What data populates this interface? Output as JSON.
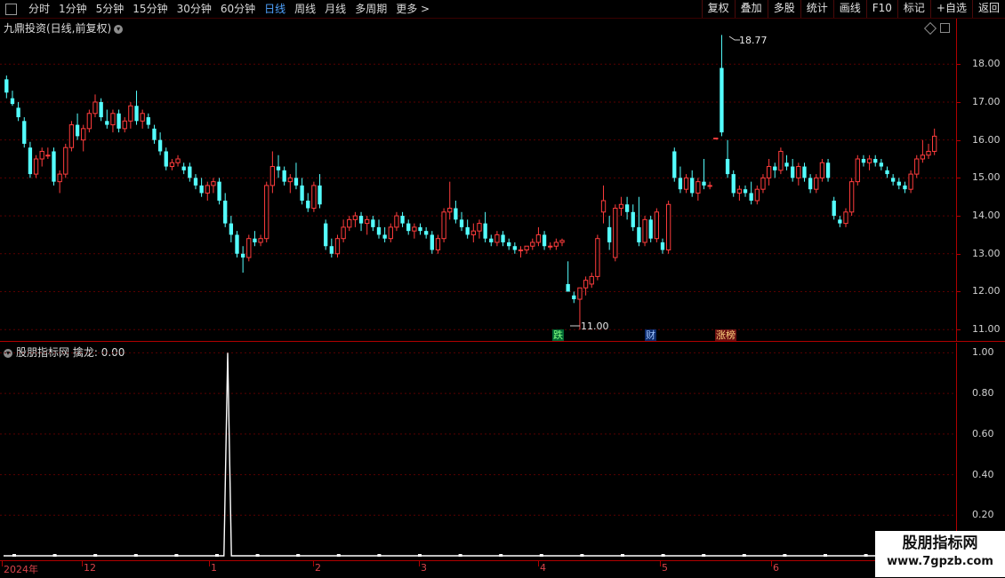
{
  "toolbar": {
    "periods": [
      {
        "label": "分时",
        "active": false
      },
      {
        "label": "1分钟",
        "active": false
      },
      {
        "label": "5分钟",
        "active": false
      },
      {
        "label": "15分钟",
        "active": false
      },
      {
        "label": "30分钟",
        "active": false
      },
      {
        "label": "60分钟",
        "active": false
      },
      {
        "label": "日线",
        "active": true
      },
      {
        "label": "周线",
        "active": false
      },
      {
        "label": "月线",
        "active": false
      },
      {
        "label": "多周期",
        "active": false
      },
      {
        "label": "更多 >",
        "active": false
      }
    ],
    "buttons": [
      "复权",
      "叠加",
      "多股",
      "统计",
      "画线",
      "F10",
      "标记",
      "+自选",
      "返回"
    ]
  },
  "main_panel": {
    "title": "九鼎投资(日线,前复权)",
    "y_ticks": [
      "18.00",
      "17.00",
      "16.00",
      "15.00",
      "14.00",
      "13.00",
      "12.00",
      "11.00"
    ],
    "high_label": "18.77",
    "low_label": "11.00",
    "markers": [
      {
        "label": "跌"
      },
      {
        "label": "财"
      },
      {
        "label": "涨榜"
      }
    ]
  },
  "sub_panel": {
    "title": "股朋指标网",
    "indicator": "擒龙: 0.00",
    "y_ticks": [
      "1.00",
      "0.80",
      "0.60",
      "0.40",
      "0.20"
    ]
  },
  "timeline": {
    "labels": [
      "2024年",
      "12",
      "1",
      "2",
      "3",
      "4",
      "5",
      "6"
    ]
  },
  "watermark": {
    "title": "股朋指标网",
    "url": "www.7gpzb.com"
  },
  "colors": {
    "up": "#ff3c3c",
    "down": "#54ffff",
    "grid": "#5a0000",
    "axis": "#b00000",
    "active_tab": "#4fa3ff"
  },
  "chart_data": {
    "type": "candlestick",
    "y_range": [
      10.7,
      19.2
    ],
    "indicator_range": [
      0,
      1.05
    ],
    "candles": [
      [
        17.6,
        17.7,
        17.1,
        17.25
      ],
      [
        17.1,
        17.3,
        16.9,
        16.95
      ],
      [
        16.85,
        17.0,
        16.5,
        16.6
      ],
      [
        16.5,
        16.6,
        15.8,
        15.9
      ],
      [
        15.8,
        15.95,
        15.0,
        15.1
      ],
      [
        15.1,
        15.6,
        15.0,
        15.5
      ],
      [
        15.5,
        15.8,
        15.3,
        15.7
      ],
      [
        15.6,
        15.8,
        15.5,
        15.6
      ],
      [
        15.7,
        15.8,
        14.8,
        14.9
      ],
      [
        14.9,
        15.2,
        14.6,
        15.1
      ],
      [
        15.1,
        15.9,
        15.0,
        15.8
      ],
      [
        15.8,
        16.5,
        15.7,
        16.4
      ],
      [
        16.4,
        16.7,
        16.0,
        16.1
      ],
      [
        16.0,
        16.4,
        15.7,
        16.3
      ],
      [
        16.3,
        16.8,
        16.2,
        16.7
      ],
      [
        16.7,
        17.2,
        16.6,
        17.0
      ],
      [
        17.0,
        17.1,
        16.5,
        16.6
      ],
      [
        16.5,
        16.8,
        16.3,
        16.4
      ],
      [
        16.4,
        16.8,
        16.2,
        16.7
      ],
      [
        16.7,
        16.8,
        16.2,
        16.3
      ],
      [
        16.3,
        16.6,
        16.2,
        16.5
      ],
      [
        16.5,
        17.0,
        16.3,
        16.9
      ],
      [
        16.9,
        17.3,
        16.4,
        16.5
      ],
      [
        16.5,
        16.8,
        16.3,
        16.7
      ],
      [
        16.6,
        16.7,
        16.3,
        16.4
      ],
      [
        16.3,
        16.4,
        15.9,
        16.0
      ],
      [
        16.0,
        16.2,
        15.6,
        15.7
      ],
      [
        15.7,
        15.8,
        15.2,
        15.3
      ],
      [
        15.3,
        15.5,
        15.2,
        15.4
      ],
      [
        15.4,
        15.6,
        15.3,
        15.5
      ],
      [
        15.3,
        15.4,
        15.1,
        15.2
      ],
      [
        15.3,
        15.4,
        14.9,
        15.0
      ],
      [
        15.0,
        15.1,
        14.7,
        14.8
      ],
      [
        14.8,
        15.0,
        14.5,
        14.6
      ],
      [
        14.6,
        14.9,
        14.4,
        14.8
      ],
      [
        14.8,
        15.0,
        14.6,
        14.9
      ],
      [
        14.9,
        15.0,
        14.3,
        14.4
      ],
      [
        14.4,
        14.6,
        13.7,
        13.8
      ],
      [
        13.8,
        14.0,
        13.3,
        13.5
      ],
      [
        13.5,
        13.6,
        12.9,
        13.0
      ],
      [
        13.0,
        13.2,
        12.5,
        12.9
      ],
      [
        12.9,
        13.5,
        12.8,
        13.4
      ],
      [
        13.4,
        13.6,
        13.2,
        13.3
      ],
      [
        13.3,
        13.5,
        13.2,
        13.4
      ],
      [
        13.4,
        14.9,
        13.3,
        14.8
      ],
      [
        14.8,
        15.7,
        14.6,
        15.3
      ],
      [
        15.3,
        15.6,
        15.0,
        15.2
      ],
      [
        15.2,
        15.3,
        14.8,
        14.9
      ],
      [
        14.9,
        15.1,
        14.6,
        15.0
      ],
      [
        15.0,
        15.4,
        14.7,
        14.8
      ],
      [
        14.8,
        15.0,
        14.3,
        14.4
      ],
      [
        14.4,
        14.6,
        14.1,
        14.2
      ],
      [
        14.2,
        14.9,
        14.1,
        14.8
      ],
      [
        14.8,
        15.1,
        14.2,
        14.3
      ],
      [
        13.8,
        13.9,
        13.1,
        13.2
      ],
      [
        13.2,
        13.4,
        12.9,
        13.0
      ],
      [
        13.0,
        13.5,
        12.9,
        13.4
      ],
      [
        13.4,
        13.9,
        13.3,
        13.7
      ],
      [
        13.7,
        14.0,
        13.6,
        13.9
      ],
      [
        13.9,
        14.1,
        13.7,
        14.0
      ],
      [
        14.0,
        14.1,
        13.6,
        13.8
      ],
      [
        13.8,
        14.0,
        13.5,
        13.9
      ],
      [
        13.9,
        14.0,
        13.6,
        13.7
      ],
      [
        13.7,
        13.9,
        13.4,
        13.5
      ],
      [
        13.5,
        13.7,
        13.3,
        13.4
      ],
      [
        13.4,
        13.8,
        13.3,
        13.7
      ],
      [
        13.7,
        14.1,
        13.6,
        14.0
      ],
      [
        14.0,
        14.1,
        13.7,
        13.8
      ],
      [
        13.8,
        13.9,
        13.5,
        13.6
      ],
      [
        13.6,
        13.8,
        13.4,
        13.7
      ],
      [
        13.7,
        13.8,
        13.5,
        13.6
      ],
      [
        13.6,
        13.7,
        13.4,
        13.5
      ],
      [
        13.5,
        13.6,
        13.0,
        13.1
      ],
      [
        13.1,
        13.5,
        13.0,
        13.4
      ],
      [
        13.4,
        14.2,
        13.3,
        14.1
      ],
      [
        14.1,
        14.9,
        13.9,
        14.2
      ],
      [
        14.2,
        14.4,
        13.8,
        13.9
      ],
      [
        13.9,
        14.1,
        13.6,
        13.7
      ],
      [
        13.7,
        13.9,
        13.4,
        13.5
      ],
      [
        13.5,
        13.8,
        13.3,
        13.6
      ],
      [
        13.6,
        13.9,
        13.4,
        13.8
      ],
      [
        13.8,
        14.1,
        13.3,
        13.4
      ],
      [
        13.4,
        13.5,
        13.2,
        13.3
      ],
      [
        13.3,
        13.6,
        13.2,
        13.5
      ],
      [
        13.5,
        13.6,
        13.2,
        13.3
      ],
      [
        13.3,
        13.4,
        13.1,
        13.2
      ],
      [
        13.2,
        13.3,
        13.0,
        13.1
      ],
      [
        13.1,
        13.2,
        12.9,
        13.1
      ],
      [
        13.1,
        13.2,
        13.0,
        13.2
      ],
      [
        13.2,
        13.4,
        13.1,
        13.3
      ],
      [
        13.3,
        13.7,
        13.2,
        13.5
      ],
      [
        13.5,
        13.6,
        13.1,
        13.2
      ],
      [
        13.2,
        13.3,
        13.1,
        13.2
      ],
      [
        13.2,
        13.4,
        13.1,
        13.3
      ],
      [
        13.3,
        13.4,
        13.2,
        13.35
      ],
      [
        12.2,
        12.8,
        12.0,
        12.0
      ],
      [
        11.9,
        12.0,
        11.7,
        11.8
      ],
      [
        11.8,
        12.1,
        11.0,
        12.1
      ],
      [
        12.1,
        12.4,
        11.9,
        12.3
      ],
      [
        12.2,
        12.5,
        12.1,
        12.4
      ],
      [
        12.4,
        13.5,
        12.3,
        13.4
      ],
      [
        14.1,
        14.8,
        13.8,
        14.4
      ],
      [
        13.7,
        14.0,
        13.1,
        13.3
      ],
      [
        12.9,
        14.3,
        12.8,
        14.2
      ],
      [
        14.2,
        14.5,
        14.0,
        14.3
      ],
      [
        14.3,
        14.5,
        13.9,
        14.1
      ],
      [
        14.1,
        14.3,
        13.6,
        13.7
      ],
      [
        13.7,
        14.5,
        13.2,
        13.3
      ],
      [
        13.3,
        14.0,
        13.2,
        13.9
      ],
      [
        13.9,
        14.0,
        13.3,
        13.4
      ],
      [
        13.4,
        14.2,
        13.3,
        14.1
      ],
      [
        13.3,
        13.4,
        13.0,
        13.1
      ],
      [
        13.1,
        14.4,
        13.0,
        14.3
      ],
      [
        15.7,
        15.8,
        14.9,
        15.0
      ],
      [
        15.0,
        15.3,
        14.6,
        14.7
      ],
      [
        14.7,
        15.1,
        14.6,
        15.0
      ],
      [
        15.0,
        15.2,
        14.5,
        14.6
      ],
      [
        14.6,
        15.0,
        14.4,
        14.9
      ],
      [
        14.9,
        15.5,
        14.7,
        14.8
      ],
      [
        14.8,
        14.9,
        14.7,
        14.8
      ],
      [
        16.05,
        16.05,
        16.05,
        16.05
      ],
      [
        17.9,
        18.77,
        16.1,
        16.2
      ],
      [
        15.5,
        16.0,
        15.0,
        15.1
      ],
      [
        15.1,
        15.2,
        14.5,
        14.6
      ],
      [
        14.6,
        14.8,
        14.4,
        14.7
      ],
      [
        14.7,
        14.8,
        14.5,
        14.6
      ],
      [
        14.6,
        14.9,
        14.3,
        14.4
      ],
      [
        14.4,
        14.8,
        14.3,
        14.7
      ],
      [
        14.7,
        15.1,
        14.6,
        15.0
      ],
      [
        15.0,
        15.5,
        14.8,
        15.3
      ],
      [
        15.3,
        15.4,
        15.0,
        15.2
      ],
      [
        15.2,
        15.8,
        15.1,
        15.7
      ],
      [
        15.4,
        15.6,
        15.2,
        15.3
      ],
      [
        15.3,
        15.5,
        14.9,
        15.0
      ],
      [
        15.0,
        15.4,
        14.8,
        15.3
      ],
      [
        15.3,
        15.4,
        14.9,
        15.0
      ],
      [
        15.0,
        15.1,
        14.6,
        14.7
      ],
      [
        14.7,
        15.1,
        14.6,
        15.0
      ],
      [
        15.0,
        15.5,
        14.9,
        15.4
      ],
      [
        15.4,
        15.5,
        14.9,
        15.0
      ],
      [
        14.4,
        14.5,
        13.9,
        14.0
      ],
      [
        13.9,
        14.0,
        13.7,
        13.8
      ],
      [
        13.8,
        14.2,
        13.7,
        14.1
      ],
      [
        14.1,
        15.0,
        14.0,
        14.9
      ],
      [
        14.9,
        15.6,
        14.8,
        15.5
      ],
      [
        15.5,
        15.6,
        15.3,
        15.4
      ],
      [
        15.4,
        15.6,
        15.2,
        15.5
      ],
      [
        15.5,
        15.6,
        15.3,
        15.4
      ],
      [
        15.4,
        15.5,
        15.2,
        15.3
      ],
      [
        15.2,
        15.3,
        15.0,
        15.1
      ],
      [
        15.0,
        15.1,
        14.8,
        14.9
      ],
      [
        14.9,
        15.0,
        14.7,
        14.8
      ],
      [
        14.8,
        14.9,
        14.6,
        14.7
      ],
      [
        14.7,
        15.2,
        14.6,
        15.1
      ],
      [
        15.1,
        15.6,
        15.0,
        15.5
      ],
      [
        15.5,
        16.0,
        15.4,
        15.6
      ],
      [
        15.6,
        15.9,
        15.5,
        15.7
      ],
      [
        15.7,
        16.3,
        15.6,
        16.1
      ]
    ],
    "indicator_values": [
      0,
      0,
      0,
      0,
      0,
      0,
      0,
      0,
      0,
      0,
      0,
      0,
      0,
      0,
      0,
      0,
      0,
      0,
      0,
      0,
      0,
      0,
      0,
      0,
      0,
      0,
      0,
      0,
      0,
      0,
      0,
      0,
      0,
      0,
      0,
      0,
      0,
      0,
      0,
      0,
      0,
      0,
      0,
      0,
      0,
      0,
      0,
      0,
      0,
      0,
      0,
      0,
      0,
      0,
      0,
      0,
      0,
      0,
      0,
      0,
      1,
      0,
      0,
      0,
      0,
      0,
      0,
      0,
      0,
      0,
      0,
      0,
      0,
      0,
      0,
      0,
      0,
      0,
      0,
      0,
      0,
      0,
      0,
      0,
      0,
      0,
      0,
      0,
      0,
      0,
      0,
      0,
      0,
      0,
      0,
      0,
      0,
      0,
      0,
      0,
      0,
      0,
      0,
      0,
      0,
      0,
      0,
      0,
      0,
      0,
      0,
      0,
      0,
      0,
      0,
      0,
      0,
      0,
      0,
      0,
      0,
      0,
      0,
      0,
      0,
      0,
      0,
      0,
      0,
      0,
      0,
      0,
      0,
      0,
      0,
      0,
      0,
      0,
      0,
      0,
      0,
      0,
      0,
      0,
      0,
      0,
      0,
      0,
      0,
      0,
      0,
      0,
      0,
      0,
      0,
      0,
      0,
      0,
      0,
      0,
      0,
      0,
      0,
      0,
      0,
      0,
      0,
      0,
      0,
      0,
      0,
      0,
      0,
      0,
      0,
      0,
      0,
      0,
      0,
      0,
      0,
      0,
      0,
      0,
      0,
      0,
      0,
      0,
      0,
      0,
      0,
      0,
      0,
      0,
      0,
      0,
      0,
      0,
      0,
      0,
      0,
      0,
      0,
      0,
      0,
      0,
      0,
      0,
      0,
      0,
      0,
      0,
      0,
      0,
      0,
      0,
      0,
      0,
      0,
      0,
      0,
      0,
      0,
      0,
      0,
      0,
      0,
      0,
      0,
      0,
      0,
      0,
      0,
      0,
      0,
      0,
      0,
      0,
      0,
      0,
      0,
      0,
      0,
      0,
      0,
      0,
      0,
      0,
      0,
      0
    ]
  }
}
